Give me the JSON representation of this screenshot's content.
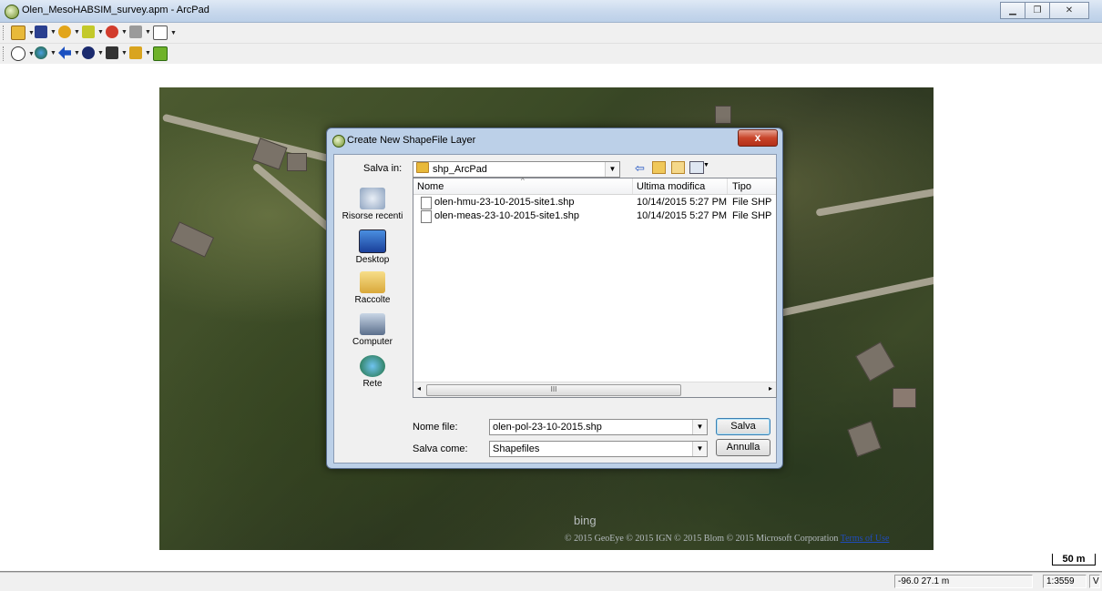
{
  "window": {
    "title": "Olen_MesoHABSIM_survey.apm - ArcPad",
    "controls": [
      "minimize-icon",
      "maximize-icon",
      "close-icon"
    ]
  },
  "toolbar1": {
    "items": [
      {
        "icon": "open-folder-icon",
        "dropdown": true
      },
      {
        "icon": "save-icon",
        "dropdown": true
      },
      {
        "icon": "add-layer-icon",
        "dropdown": true
      },
      {
        "icon": "edit-icon",
        "dropdown": true
      },
      {
        "icon": "gps-icon",
        "dropdown": true
      },
      {
        "icon": "tools-icon",
        "dropdown": true
      },
      {
        "icon": "help-icon",
        "dropdown": true
      }
    ]
  },
  "toolbar2": {
    "items": [
      {
        "icon": "zoom-in-icon",
        "dropdown": true
      },
      {
        "icon": "globe-icon",
        "dropdown": true
      },
      {
        "icon": "back-arrow-icon",
        "dropdown": true
      },
      {
        "icon": "identify-icon",
        "dropdown": true
      },
      {
        "icon": "binoculars-icon",
        "dropdown": true
      },
      {
        "icon": "measure-icon",
        "dropdown": true
      },
      {
        "icon": "refresh-icon",
        "dropdown": false
      }
    ]
  },
  "map": {
    "watermark": "bing",
    "copyright": "© 2015 GeoEye © 2015 IGN © 2015 Blom © 2015 Microsoft Corporation",
    "terms_link": "Terms of Use",
    "scale_label": "50 m"
  },
  "statusbar": {
    "coords": "-96.0 27.1 m",
    "scale": "1:3559",
    "mode": "V"
  },
  "dialog": {
    "title": "Create New ShapeFile Layer",
    "close_label": "x",
    "save_in_label": "Salva in:",
    "save_in_value": "shp_ArcPad",
    "places": [
      "Risorse recenti",
      "Desktop",
      "Raccolte",
      "Computer",
      "Rete"
    ],
    "columns": {
      "name": "Nome",
      "modified": "Ultima modifica",
      "type": "Tipo"
    },
    "files": [
      {
        "name": "olen-hmu-23-10-2015-site1.shp",
        "modified": "10/14/2015 5:27 PM",
        "type": "File SHP"
      },
      {
        "name": "olen-meas-23-10-2015-site1.shp",
        "modified": "10/14/2015 5:27 PM",
        "type": "File SHP"
      }
    ],
    "filename_label": "Nome file:",
    "filename_value": "olen-pol-23-10-2015.shp",
    "savetype_label": "Salva come:",
    "savetype_value": "Shapefiles",
    "save_button": "Salva",
    "cancel_button": "Annulla",
    "scroll_grip": "III"
  }
}
